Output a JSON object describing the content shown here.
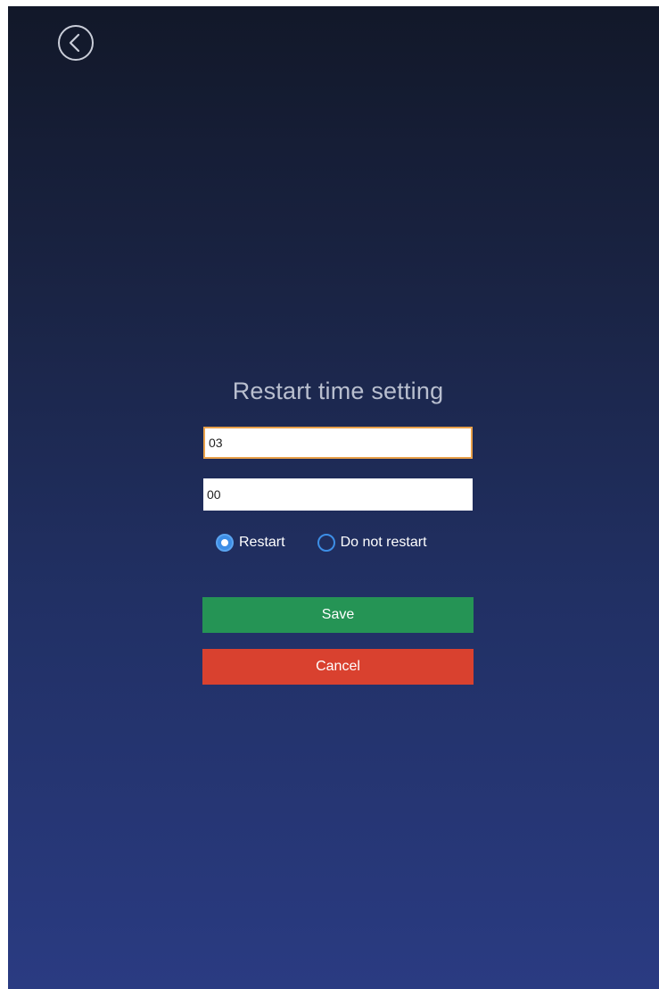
{
  "header": {
    "back_icon": "chevron-left-circle-icon"
  },
  "form": {
    "title": "Restart time setting",
    "hour_value": "03",
    "minute_value": "00",
    "radio_options": [
      {
        "label": "Restart",
        "checked": true
      },
      {
        "label": "Do not restart",
        "checked": false
      }
    ],
    "save_label": "Save",
    "cancel_label": "Cancel"
  },
  "colors": {
    "background_top": "#121829",
    "background_bottom": "#2a3b82",
    "save_button": "#259455",
    "cancel_button": "#d9412f",
    "radio_accent": "#3d8ee6",
    "focus_border": "#e8a04a"
  }
}
